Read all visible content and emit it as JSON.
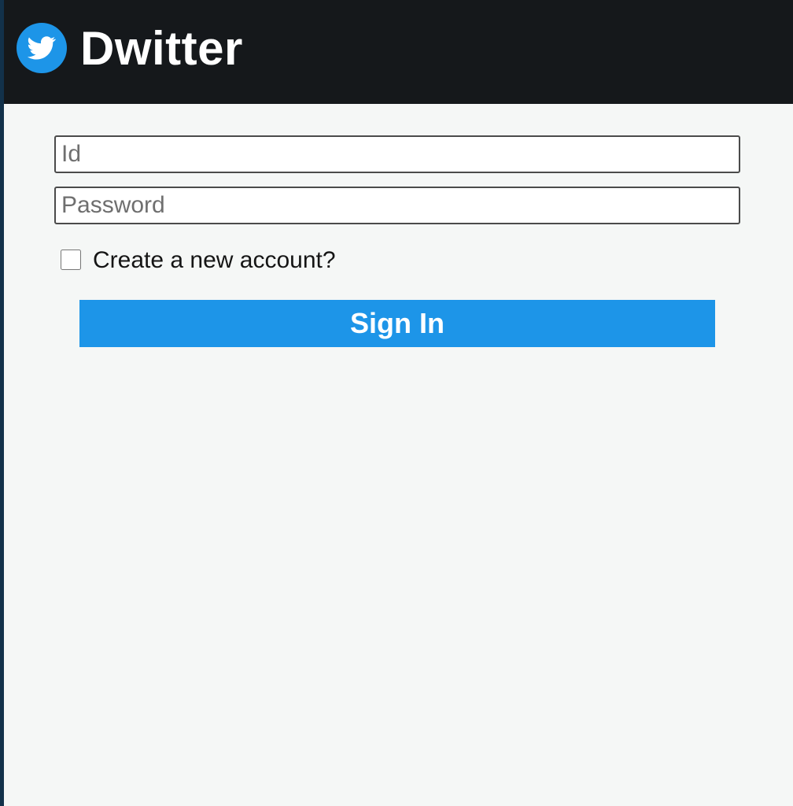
{
  "app": {
    "title": "Dwitter",
    "logo_icon": "bird-icon"
  },
  "colors": {
    "header_background": "#15181b",
    "accent": "#1d95e8",
    "page_background": "#f5f7f6"
  },
  "login": {
    "id_placeholder": "Id",
    "id_value": "",
    "password_placeholder": "Password",
    "password_value": "",
    "create_account_label": "Create a new account?",
    "create_account_checked": false,
    "submit_label": "Sign In"
  }
}
